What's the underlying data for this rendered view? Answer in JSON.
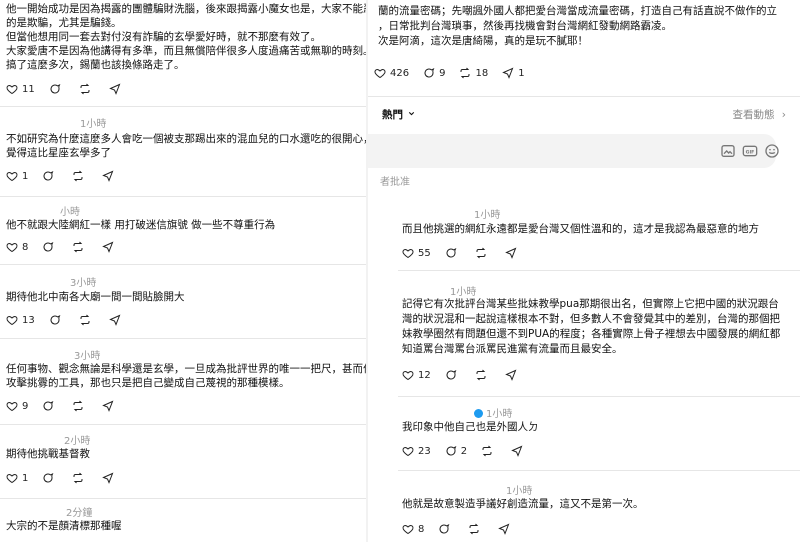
{
  "left_panel": {
    "comments": [
      {
        "time": "",
        "lines": [
          "他一開始成功是因為揭露的團體騙財洗腦，後來跟揭露小魔女也是，大家不能忍受",
          "的是欺騙，尤其是騙錢。",
          "但當他想用同一套去對付沒有詐騙的玄學愛好時，就不那麼有效了。",
          "大家愛唐不是因為他講得有多準，而且無償陪伴很多人度過痛苦或無聊的時刻。",
          "搞了這麼多次，錫蘭也該換條路走了。"
        ],
        "likes": "11"
      },
      {
        "time": "1小時",
        "lines": [
          "不如研究為什麼這麼多人會吃一個被支那踢出來的混血兒的口水還吃的很開心，我",
          "覺得這比星座玄學多了"
        ],
        "likes": "1"
      },
      {
        "time": "小時",
        "lines": [
          "他不就跟大陸網紅一樣 用打破迷信旗號 做一些不尊重行為"
        ],
        "likes": "8"
      },
      {
        "time": "3小時",
        "lines": [
          "期待他北中南各大廟一間一間貼臉開大"
        ],
        "likes": "13"
      },
      {
        "time": "3小時",
        "lines": [
          "任何事物、觀念無論是科學還是玄學，一旦成為批評世界的唯一一把尺，甚而作為",
          "攻擊挑釁的工具，那也只是把自己變成自己蔑視的那種模樣。"
        ],
        "likes": "9"
      },
      {
        "time": "2小時",
        "lines": [
          "期待他挑戰基督教"
        ],
        "likes": "1"
      },
      {
        "time": "2分鐘",
        "lines": [
          "大宗的不是顏清標那種喔"
        ],
        "likes": ""
      }
    ]
  },
  "right_panel": {
    "top_post": {
      "lines": [
        "蘭的流量密碼；先嘲諷外國人都把愛台灣當成流量密碼，打造自己有話直說不做作的立",
        "，日常批判台灣瑣事，然後再找機會對台灣網紅發動網路霸凌。",
        "次是阿滴，這次是唐綺陽，真的是玩不膩耶！"
      ],
      "likes": "426",
      "replies": "9",
      "reposts": "18",
      "shares": "1"
    },
    "hot_label": "熱門",
    "view_activity": "查看動態",
    "reply_note": "者批准",
    "comments": [
      {
        "time": "1小時",
        "lines": [
          "而且他挑選的網紅永遠都是愛台灣又個性溫和的，這才是我認為最惡意的地方"
        ],
        "likes": "55",
        "replies": ""
      },
      {
        "time": "1小時",
        "lines": [
          "記得它有次批評台灣某些批妹教學pua那期很出名，但實際上它把中國的狀況跟台",
          "灣的狀況混和一起說這樣根本不對，但多數人不會發覺其中的差別，台灣的那個把",
          "妹教學圈然有問題但還不到PUA的程度；各種實際上骨子裡想去中國發展的網紅都",
          "知道罵台灣罵台派罵民進黨有流量而且最安全。"
        ],
        "likes": "12",
        "replies": ""
      },
      {
        "time": "1小時",
        "lines": [
          "我印象中他自己也是外國人ㄉ"
        ],
        "likes": "23",
        "replies": "2"
      },
      {
        "time": "1小時",
        "lines": [
          "他就是故意製造爭議好創造流量，這又不是第一次。"
        ],
        "likes": "8",
        "replies": ""
      }
    ]
  },
  "colors": {
    "verified": "#1d9bf0",
    "divider": "#e6e6e6",
    "meta": "#999999"
  }
}
